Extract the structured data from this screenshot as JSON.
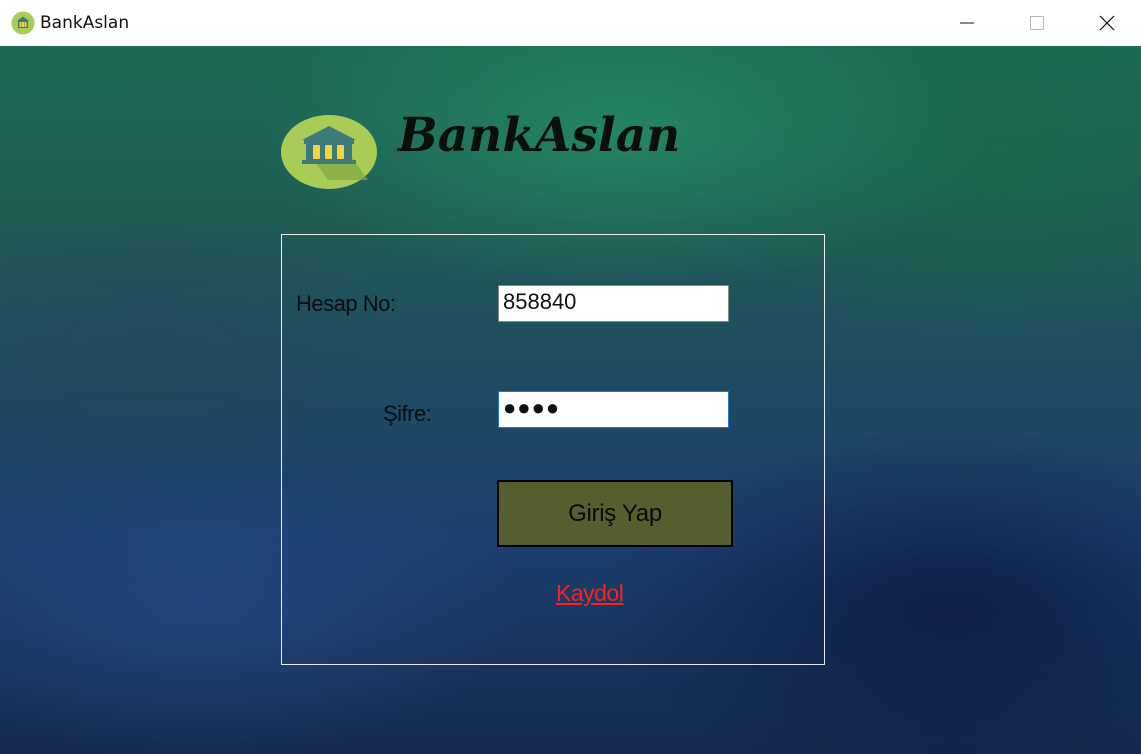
{
  "window": {
    "title": "BankAslan",
    "controls": {
      "minimize_icon": "minimize-icon",
      "maximize_icon": "maximize-icon",
      "close_icon": "close-icon"
    }
  },
  "header": {
    "brand_name": "BankAslan",
    "logo_icon": "bank-icon"
  },
  "login_form": {
    "account_label": "Hesap No:",
    "account_value": "858840",
    "password_label": "Şifre:",
    "password_value": "●●●●",
    "login_button": "Giriş Yap",
    "register_link": "Kaydol"
  },
  "colors": {
    "login_button_bg": "#545e2f",
    "register_link": "#ff1f1f",
    "logo_circle": "#a9cc57",
    "logo_columns": "#f2d53a",
    "logo_building": "#3e7a7a",
    "focus_border": "#1a78d0"
  }
}
